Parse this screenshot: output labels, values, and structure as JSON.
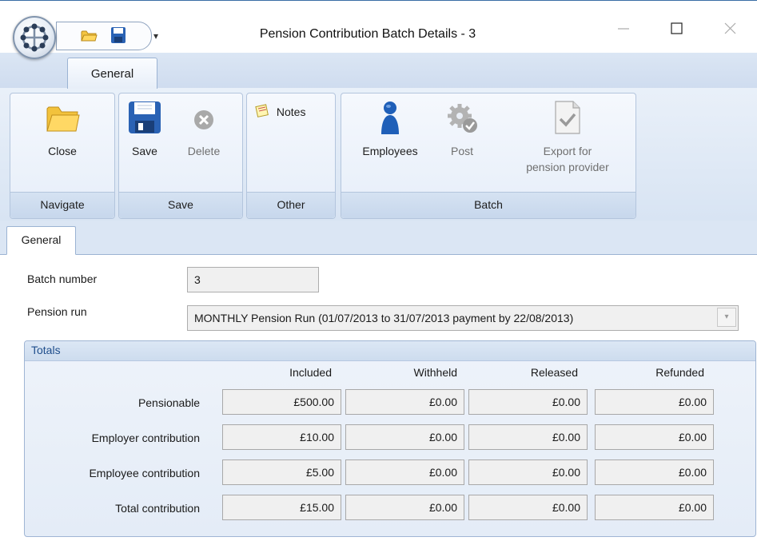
{
  "window": {
    "title": "Pension Contribution Batch Details - 3",
    "minimize_glyph": "—",
    "maximize_glyph": "☐",
    "close_glyph": "✕",
    "qat_dropdown_glyph": "▾"
  },
  "ribbon": {
    "active_tab": "General",
    "groups": {
      "navigate": {
        "caption": "Navigate",
        "close": "Close"
      },
      "save": {
        "caption": "Save",
        "save": "Save",
        "delete": "Delete"
      },
      "other": {
        "caption": "Other",
        "notes": "Notes"
      },
      "batch": {
        "caption": "Batch",
        "employees": "Employees",
        "post": "Post",
        "export_line1": "Export for",
        "export_line2": "pension provider"
      }
    }
  },
  "form": {
    "tab": "General",
    "batch_number_label": "Batch number",
    "batch_number_value": "3",
    "pension_run_label": "Pension run",
    "pension_run_value": "MONTHLY Pension Run  (01/07/2013 to 31/07/2013  payment by 22/08/2013)"
  },
  "totals": {
    "title": "Totals",
    "columns": [
      "Included",
      "Withheld",
      "Released",
      "Refunded"
    ],
    "rows": [
      {
        "label": "Pensionable",
        "values": [
          "£500.00",
          "£0.00",
          "£0.00",
          "£0.00"
        ]
      },
      {
        "label": "Employer contribution",
        "values": [
          "£10.00",
          "£0.00",
          "£0.00",
          "£0.00"
        ]
      },
      {
        "label": "Employee contribution",
        "values": [
          "£5.00",
          "£0.00",
          "£0.00",
          "£0.00"
        ]
      },
      {
        "label": "Total contribution",
        "values": [
          "£15.00",
          "£0.00",
          "£0.00",
          "£0.00"
        ]
      }
    ]
  },
  "icons": [
    "app-orb-icon",
    "folder-icon",
    "save-icon",
    "delete-icon",
    "notes-icon",
    "employees-icon",
    "post-icon",
    "export-icon"
  ],
  "colors": {
    "ribbon_bg": "#dbe6f4",
    "panel_header_text": "#1f4e8c",
    "field_bg": "#f0f0f0"
  }
}
